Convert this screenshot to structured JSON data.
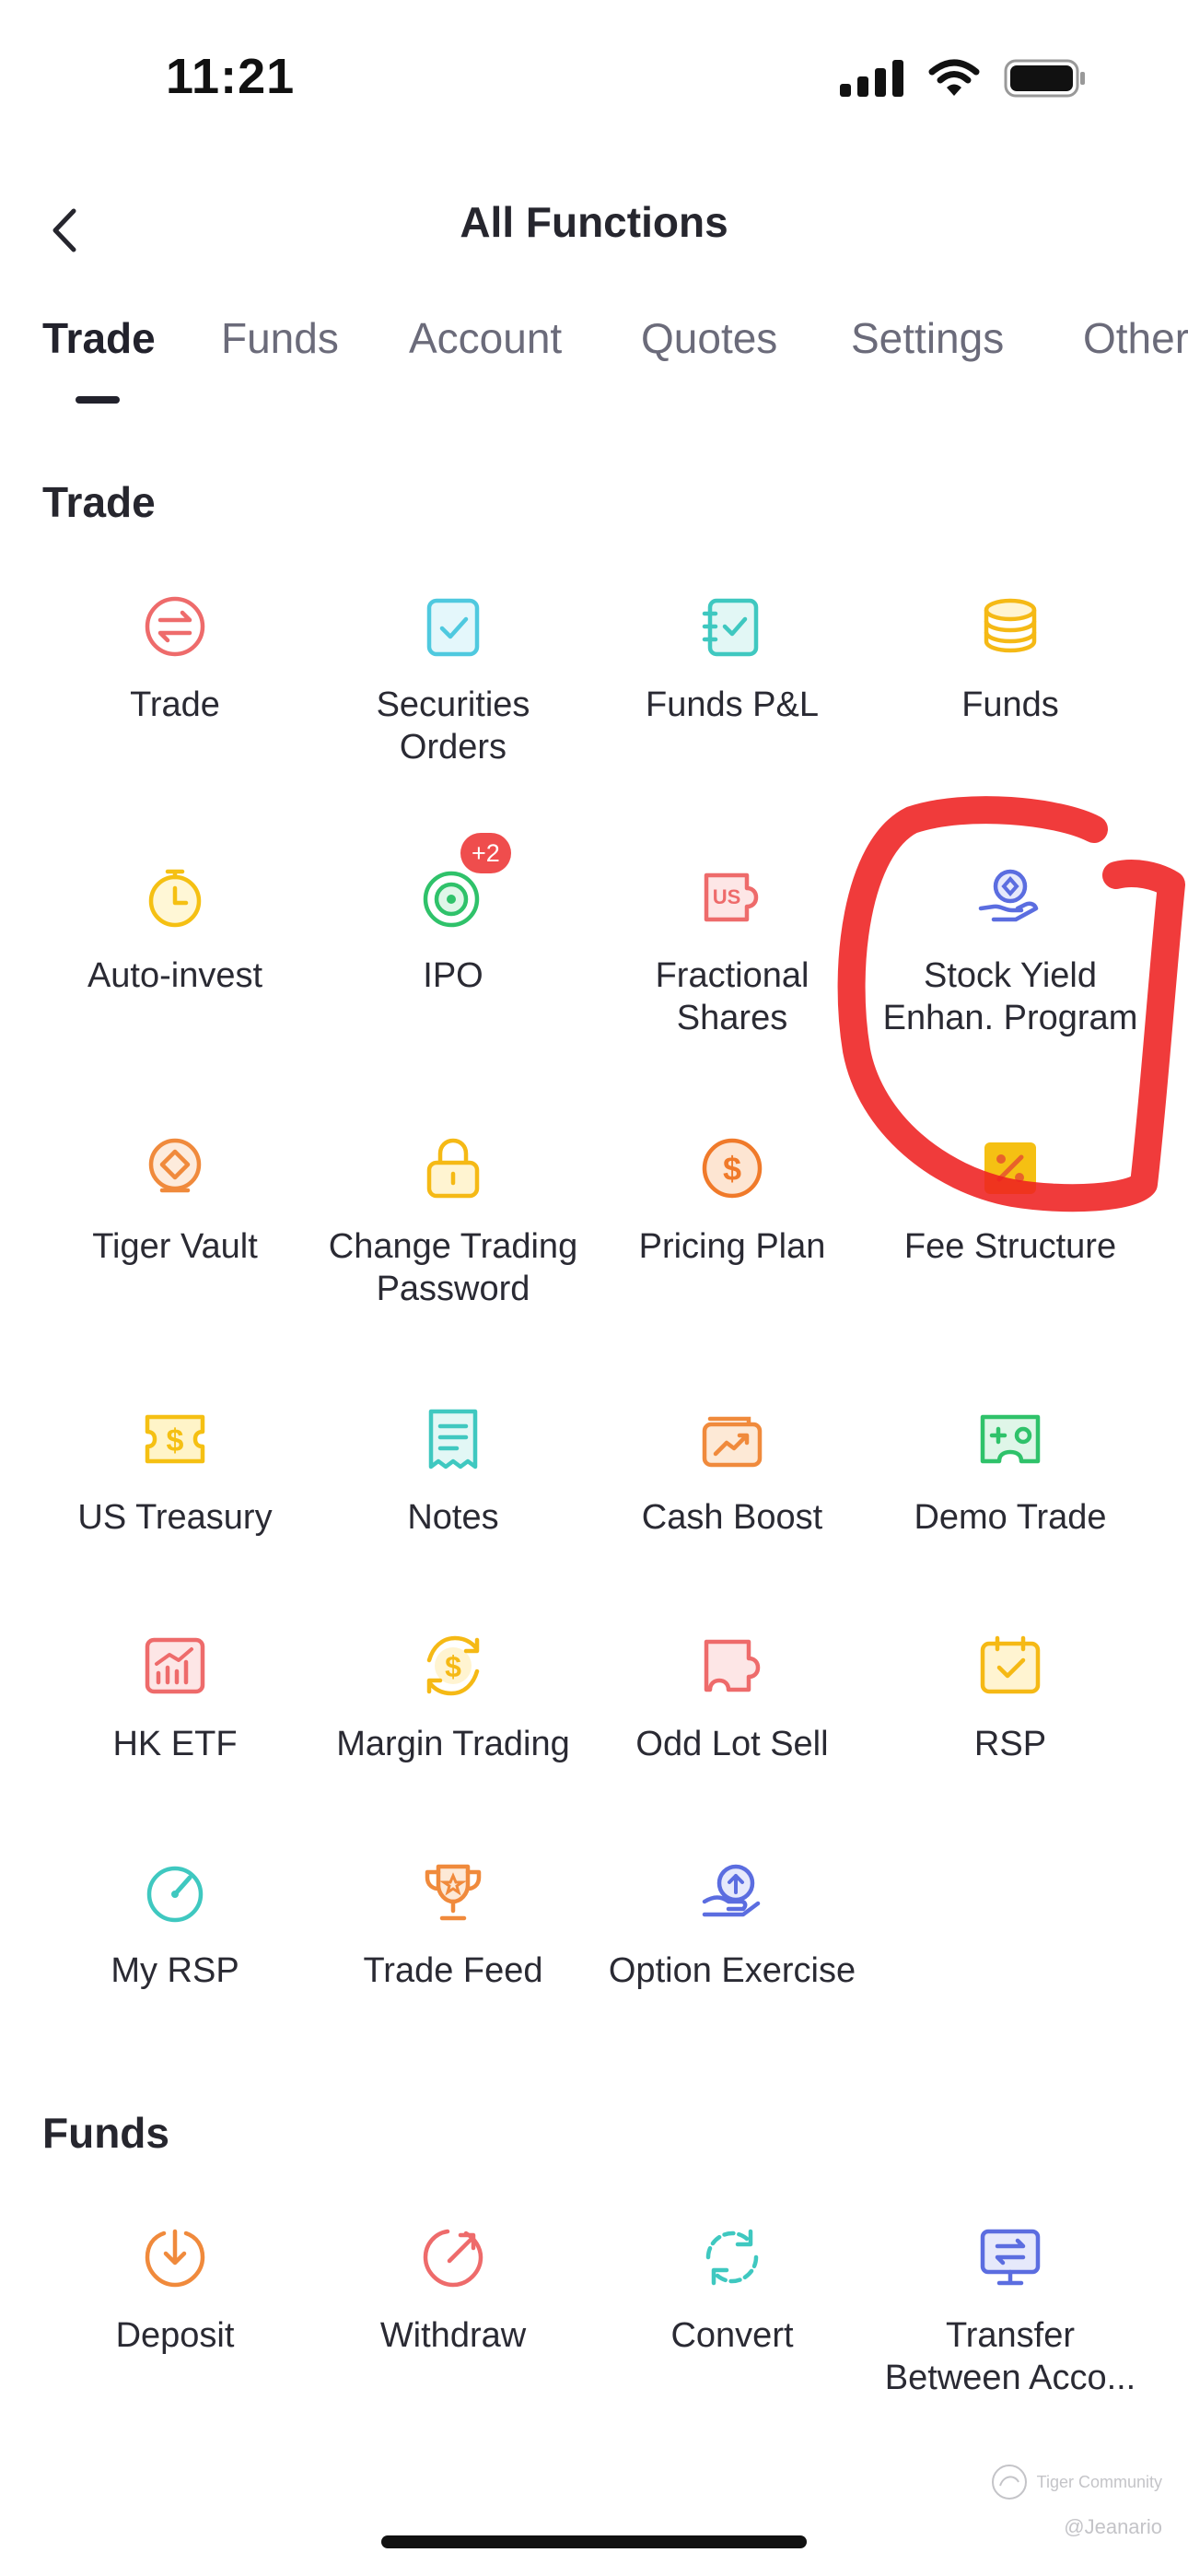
{
  "status_bar": {
    "time": "11:21"
  },
  "header": {
    "title": "All Functions"
  },
  "tabs": [
    {
      "label": "Trade",
      "active": true
    },
    {
      "label": "Funds",
      "active": false
    },
    {
      "label": "Account",
      "active": false
    },
    {
      "label": "Quotes",
      "active": false
    },
    {
      "label": "Settings",
      "active": false
    },
    {
      "label": "Others",
      "active": false
    }
  ],
  "sections": {
    "trade": {
      "title": "Trade",
      "items": [
        {
          "label": "Trade",
          "icon": "trade-swap-icon",
          "color": "#ee6b6b"
        },
        {
          "label": "Securities Orders",
          "icon": "checklist-icon",
          "color": "#4fc9df"
        },
        {
          "label": "Funds P&L",
          "icon": "notebook-check-icon",
          "color": "#3fc8c0"
        },
        {
          "label": "Funds",
          "icon": "coin-stack-icon",
          "color": "#f5b915"
        },
        {
          "label": "Auto-invest",
          "icon": "stopwatch-icon",
          "color": "#f5c013"
        },
        {
          "label": "IPO",
          "icon": "target-icon",
          "color": "#2fc26a",
          "badge": "+2"
        },
        {
          "label": "Fractional Shares",
          "icon": "us-puzzle-icon",
          "color": "#ee6b6b"
        },
        {
          "label": "Stock Yield Enhan. Program",
          "icon": "hand-diamond-icon",
          "color": "#5b6de0"
        },
        {
          "label": "Tiger Vault",
          "icon": "vault-icon",
          "color": "#f08a3c"
        },
        {
          "label": "Change Trading Password",
          "icon": "lock-icon",
          "color": "#f5b915"
        },
        {
          "label": "Pricing Plan",
          "icon": "dollar-circle-icon",
          "color": "#f07a2a"
        },
        {
          "label": "Fee Structure",
          "icon": "percent-icon",
          "color": "#f5b915"
        },
        {
          "label": "US Treasury",
          "icon": "ticket-dollar-icon",
          "color": "#f5c013"
        },
        {
          "label": "Notes",
          "icon": "receipt-icon",
          "color": "#3fc8c0"
        },
        {
          "label": "Cash Boost",
          "icon": "wallet-chart-icon",
          "color": "#f08a3c"
        },
        {
          "label": "Demo Trade",
          "icon": "game-card-icon",
          "color": "#2fc26a"
        },
        {
          "label": "HK ETF",
          "icon": "bar-chart-icon",
          "color": "#ee6b6b"
        },
        {
          "label": "Margin Trading",
          "icon": "cycle-dollar-icon",
          "color": "#f5b915"
        },
        {
          "label": "Odd Lot Sell",
          "icon": "puzzle-icon",
          "color": "#ee6b6b"
        },
        {
          "label": "RSP",
          "icon": "calendar-check-icon",
          "color": "#f5b915"
        },
        {
          "label": "My RSP",
          "icon": "gauge-icon",
          "color": "#3fc8c0"
        },
        {
          "label": "Trade Feed",
          "icon": "trophy-icon",
          "color": "#f08a3c"
        },
        {
          "label": "Option Exercise",
          "icon": "hand-upload-icon",
          "color": "#5b6de0"
        }
      ]
    },
    "funds": {
      "title": "Funds",
      "items": [
        {
          "label": "Deposit",
          "icon": "deposit-icon",
          "color": "#f08a3c"
        },
        {
          "label": "Withdraw",
          "icon": "withdraw-icon",
          "color": "#ee6b6b"
        },
        {
          "label": "Convert",
          "icon": "convert-icon",
          "color": "#3fc8c0"
        },
        {
          "label": "Transfer Between Acco...",
          "icon": "monitor-transfer-icon",
          "color": "#5b6de0"
        }
      ]
    }
  },
  "annotation_color": "#ee2020",
  "watermark": {
    "brand": "Tiger Community",
    "user": "@Jeanario"
  }
}
